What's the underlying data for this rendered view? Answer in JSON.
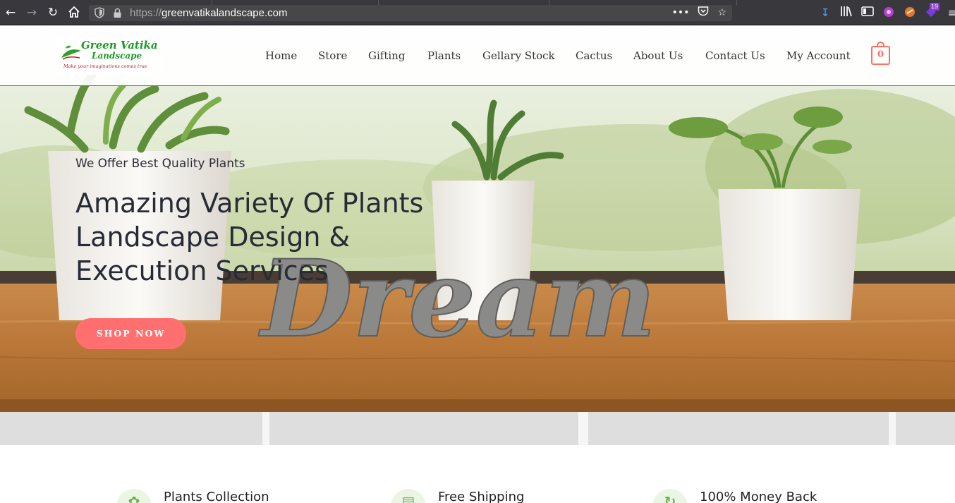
{
  "browser": {
    "back_icon": "back-arrow-icon",
    "forward_icon": "forward-arrow-icon",
    "reload_icon": "reload-icon",
    "home_icon": "home-icon",
    "url_scheme": "https://",
    "url_host": "greenvatikalandscape.com",
    "notification_count": "19"
  },
  "header": {
    "logo": {
      "title": "Green Vatika",
      "subtitle": "Landscape",
      "tagline": "Make your imaginations comes true"
    },
    "nav": [
      {
        "label": "Home"
      },
      {
        "label": "Store"
      },
      {
        "label": "Gifting"
      },
      {
        "label": "Plants"
      },
      {
        "label": "Gellary Stock"
      },
      {
        "label": "Cactus"
      },
      {
        "label": "About Us"
      },
      {
        "label": "Contact Us"
      },
      {
        "label": "My Account"
      }
    ],
    "cart_count": "0"
  },
  "hero": {
    "kicker": "We Offer Best Quality Plants",
    "title_lines": [
      "Amazing Variety Of Plants",
      "Landscape Design &",
      "Execution Services"
    ],
    "button": "SHOP NOW",
    "decor_word": "Dream"
  },
  "features": [
    {
      "title": "Plants Collection",
      "icon": "plant-icon"
    },
    {
      "title": "Free Shipping",
      "icon": "truck-icon"
    },
    {
      "title": "100% Money Back",
      "icon": "money-back-icon"
    }
  ],
  "colors": {
    "accent": "#ff6f6f",
    "brand_green": "#1d9a26",
    "header_border": "#2f8f2f",
    "feature_green": "#64b842"
  }
}
